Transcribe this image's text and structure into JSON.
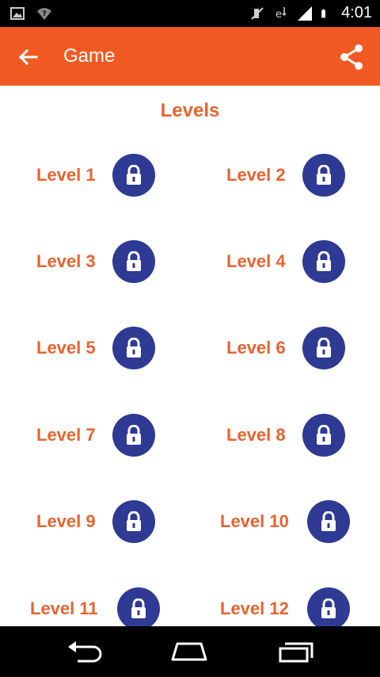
{
  "status_bar": {
    "time": "4:01",
    "icons": [
      "image-icon",
      "wifi-question-icon",
      "mute-icon",
      "data-icon",
      "signal-icon",
      "battery-icon"
    ]
  },
  "app_bar": {
    "title": "Game",
    "back_icon": "arrow-back-icon",
    "share_icon": "share-icon",
    "color": "#F05A22"
  },
  "section_title": "Levels",
  "accent_color": "#E8632F",
  "lock_color": "#2E3A93",
  "levels": [
    {
      "label": "Level 1",
      "icon": "lock-icon"
    },
    {
      "label": "Level 2",
      "icon": "lock-icon"
    },
    {
      "label": "Level 3",
      "icon": "lock-icon"
    },
    {
      "label": "Level 4",
      "icon": "lock-icon"
    },
    {
      "label": "Level 5",
      "icon": "lock-icon"
    },
    {
      "label": "Level 6",
      "icon": "lock-icon"
    },
    {
      "label": "Level 7",
      "icon": "lock-icon"
    },
    {
      "label": "Level 8",
      "icon": "lock-icon"
    },
    {
      "label": "Level 9",
      "icon": "lock-icon"
    },
    {
      "label": "Level 10",
      "icon": "lock-icon"
    },
    {
      "label": "Level 11",
      "icon": "lock-icon"
    },
    {
      "label": "Level 12",
      "icon": "lock-icon"
    }
  ],
  "nav_bar": {
    "buttons": [
      "back-nav-icon",
      "home-nav-icon",
      "recents-nav-icon"
    ]
  }
}
